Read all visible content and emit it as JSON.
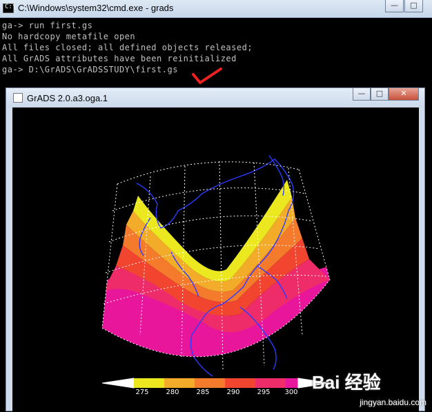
{
  "cmd_window": {
    "title": "C:\\Windows\\system32\\cmd.exe - grads",
    "icon_glyph": "C:\\",
    "lines": [
      "ga-> run first.gs",
      "No hardcopy metafile open",
      "All files closed; all defined objects released;",
      "All GrADS attributes have been reinitialized",
      "ga-> D:\\GrADS\\GrADSSTUDY\\first.gs"
    ],
    "controls": {
      "minimize": "—",
      "maximize": "□"
    }
  },
  "grads_window": {
    "title": "GrADS 2.0.a3.oga.1",
    "controls": {
      "minimize": "—",
      "maximize": "□",
      "close": "✕"
    }
  },
  "colorbar": {
    "labels": [
      "275",
      "280",
      "285",
      "290",
      "295",
      "300"
    ],
    "colors": [
      "#ece81f",
      "#f3ac2a",
      "#f47a2c",
      "#f2452f",
      "#ee2c6a",
      "#e8169a"
    ]
  },
  "map_colors": {
    "land": "#000000",
    "coast": "#2a3cff",
    "grid": "#ffffff",
    "annotation_check": "#ee2222"
  },
  "watermark": {
    "logo": "Bai 经验",
    "url": "jingyan.baidu.com"
  },
  "icons": [
    "cmd-icon",
    "grads-app-icon",
    "minimize-icon",
    "maximize-icon",
    "close-icon",
    "checkmark-icon"
  ]
}
